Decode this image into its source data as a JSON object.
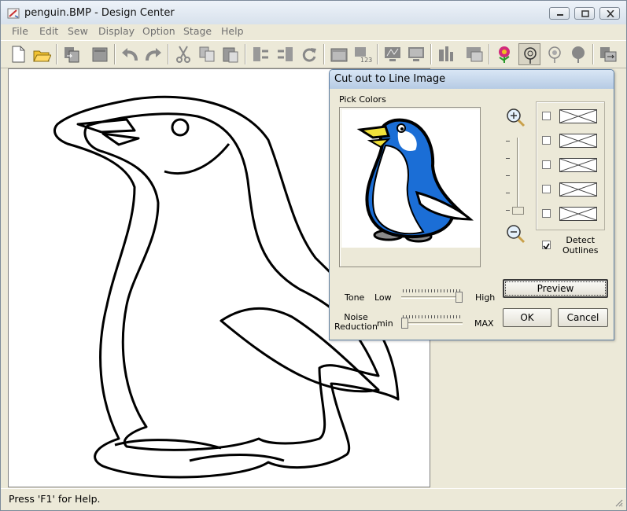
{
  "window": {
    "title": "penguin.BMP - Design Center"
  },
  "menu": [
    "File",
    "Edit",
    "Sew",
    "Display",
    "Option",
    "Stage",
    "Help"
  ],
  "toolbar": {
    "buttons": [
      "new-file",
      "open-file",
      "import",
      "stitch",
      "undo",
      "redo",
      "cut",
      "copy",
      "paste",
      "convert-back",
      "convert-forward",
      "refresh",
      "open-folder",
      "number-stage",
      "stage-line",
      "stage-display",
      "stage-figure",
      "stage-sew",
      "stage-next",
      "flower-color",
      "flower-outline",
      "flower-select",
      "hand-tool",
      "export"
    ]
  },
  "status": {
    "text": "Press 'F1' for Help."
  },
  "dialog": {
    "title": "Cut out to Line Image",
    "pick_colors_label": "Pick Colors",
    "detect_outlines_label": "Detect\nOutlines",
    "detect_outlines_checked": true,
    "color_slots": [
      {
        "checked": false
      },
      {
        "checked": false
      },
      {
        "checked": false
      },
      {
        "checked": false
      },
      {
        "checked": false
      }
    ],
    "tone": {
      "label": "Tone",
      "low": "Low",
      "high": "High",
      "value": 1.0
    },
    "noise": {
      "label": "Noise\nReduction",
      "min": "min",
      "max": "MAX",
      "value": 0.0
    },
    "preview_button": "Preview",
    "ok_button": "OK",
    "cancel_button": "Cancel",
    "colors": {
      "penguin_blue": "#1b6ed6",
      "beak_yellow": "#f2e23a",
      "feet_gray": "#8a8a8a"
    }
  }
}
